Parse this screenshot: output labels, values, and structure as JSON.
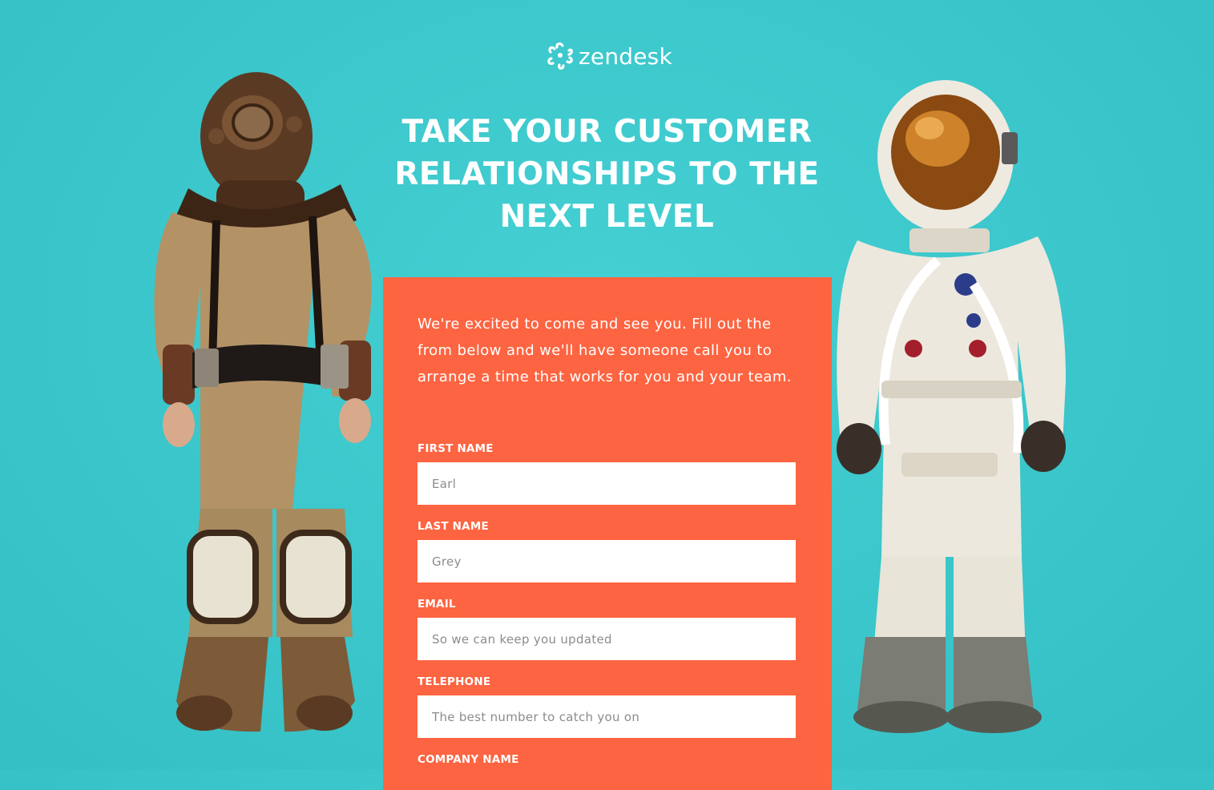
{
  "brand": {
    "name": "zendesk",
    "colors": {
      "background": "#3cc8cc",
      "card": "#fd6441",
      "text": "#ffffff"
    }
  },
  "headline": {
    "line1": "TAKE YOUR CUSTOMER",
    "line2": "RELATIONSHIPS TO THE",
    "line3": "NEXT LEVEL"
  },
  "form": {
    "intro": "We're excited to come and see you. Fill out the from below and we'll have someone call you to arrange a time that works for you and your team.",
    "first_name": {
      "label": "FIRST NAME",
      "placeholder": "Earl"
    },
    "last_name": {
      "label": "LAST NAME",
      "placeholder": "Grey"
    },
    "email": {
      "label": "EMAIL",
      "placeholder": "So we can keep you updated"
    },
    "telephone": {
      "label": "TELEPHONE",
      "placeholder": "The best number to catch you on"
    },
    "company_name": {
      "label": "COMPANY NAME"
    }
  },
  "images": {
    "left": "diving-suit-figure",
    "right": "astronaut-suit-figure"
  }
}
